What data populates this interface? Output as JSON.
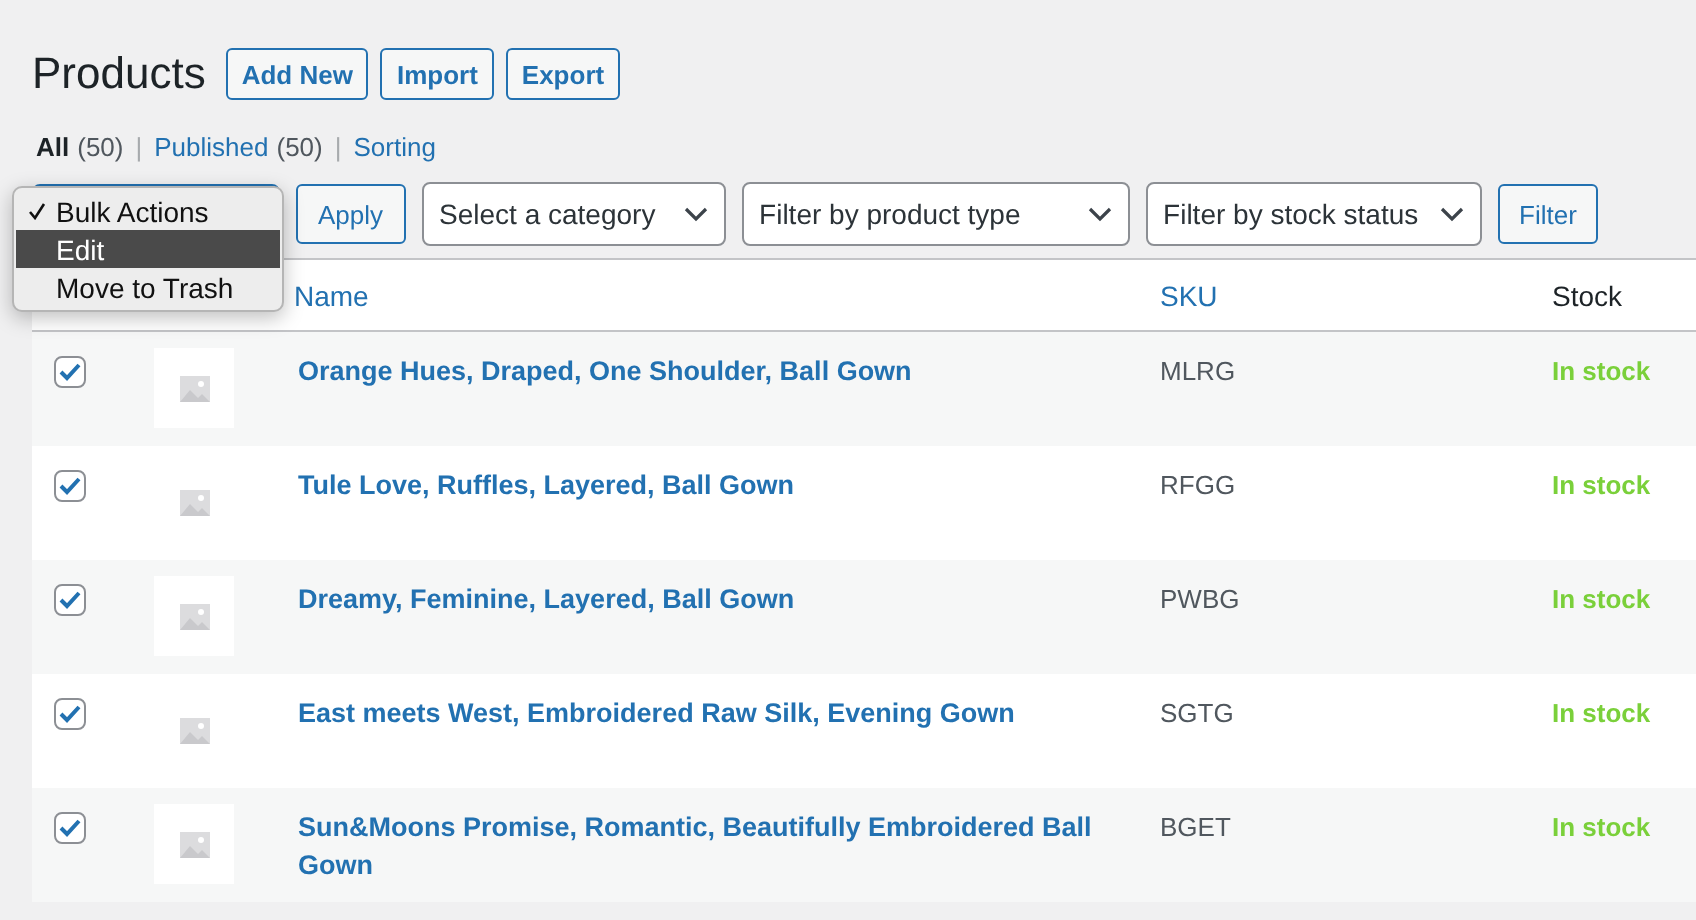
{
  "page_title": "Products",
  "title_actions": [
    "Add New",
    "Import",
    "Export"
  ],
  "views_separator": "|",
  "views": [
    {
      "label": "All",
      "count": "(50)",
      "selected": true
    },
    {
      "label": "Published",
      "count": "(50)",
      "selected": false
    },
    {
      "label": "Sorting",
      "selected": false
    }
  ],
  "bulk_actions_menu": {
    "items": [
      {
        "label": "Bulk Actions",
        "checked": true,
        "highlighted": false
      },
      {
        "label": "Edit",
        "checked": false,
        "highlighted": true
      },
      {
        "label": "Move to Trash",
        "checked": false,
        "highlighted": false
      }
    ]
  },
  "apply_button": "Apply",
  "filters": [
    {
      "value": "Select a category"
    },
    {
      "value": "Filter by product type"
    },
    {
      "value": "Filter by stock status"
    }
  ],
  "filter_button": "Filter",
  "table": {
    "columns": [
      "Name",
      "SKU",
      "Stock"
    ],
    "rows": [
      {
        "checked": true,
        "name": "Orange Hues, Draped, One Shoulder, Ball Gown",
        "sku": "MLRG",
        "stock": "In stock"
      },
      {
        "checked": true,
        "name": "Tule Love, Ruffles, Layered, Ball Gown",
        "sku": "RFGG",
        "stock": "In stock"
      },
      {
        "checked": true,
        "name": "Dreamy, Feminine, Layered, Ball Gown",
        "sku": "PWBG",
        "stock": "In stock"
      },
      {
        "checked": true,
        "name": "East meets West, Embroidered Raw Silk, Evening Gown",
        "sku": "SGTG",
        "stock": "In stock"
      },
      {
        "checked": true,
        "name": "Sun&Moons Promise, Romantic, Beautifully Embroidered Ball Gown",
        "sku": "BGET",
        "stock": "In stock"
      }
    ]
  }
}
